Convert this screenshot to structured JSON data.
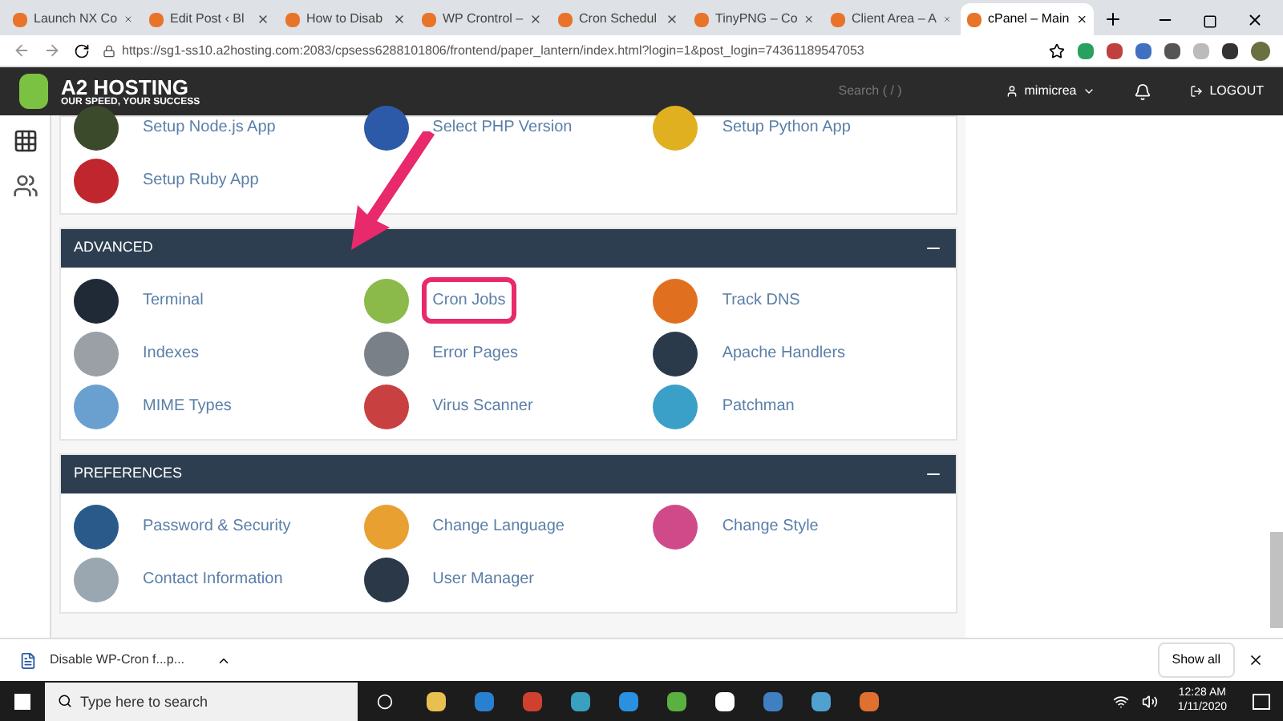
{
  "tabs": [
    {
      "label": "Launch NX Co",
      "selected": false
    },
    {
      "label": "Edit Post ‹ Bl",
      "selected": false
    },
    {
      "label": "How to Disab",
      "selected": false
    },
    {
      "label": "WP Crontrol –",
      "selected": false
    },
    {
      "label": "Cron Schedul",
      "selected": false
    },
    {
      "label": "TinyPNG – Co",
      "selected": false
    },
    {
      "label": "Client Area – A",
      "selected": false
    },
    {
      "label": "cPanel – Main",
      "selected": true
    }
  ],
  "address_bar": {
    "url": "https://sg1-ss10.a2hosting.com:2083/cpsess6288101806/frontend/paper_lantern/index.html?login=1&post_login=74361189547053"
  },
  "header": {
    "logo_title": "A2 HOSTING",
    "logo_tagline": "OUR SPEED, YOUR SUCCESS",
    "search": {
      "placeholder": "Search ( / )"
    },
    "user": "mimicrea",
    "logout": "LOGOUT"
  },
  "sections": [
    {
      "items": [
        {
          "label": "Setup Node.js App",
          "highlighted": false
        },
        {
          "label": "Select PHP Version",
          "highlighted": false
        },
        {
          "label": "Setup Python App",
          "highlighted": false
        },
        {
          "label": "Setup Ruby App",
          "highlighted": false
        }
      ]
    },
    {
      "title": "ADVANCED",
      "items": [
        {
          "label": "Terminal",
          "highlighted": false
        },
        {
          "label": "Cron Jobs",
          "highlighted": true
        },
        {
          "label": "Track DNS",
          "highlighted": false
        },
        {
          "label": "Indexes",
          "highlighted": false
        },
        {
          "label": "Error Pages",
          "highlighted": false
        },
        {
          "label": "Apache Handlers",
          "highlighted": false
        },
        {
          "label": "MIME Types",
          "highlighted": false
        },
        {
          "label": "Virus Scanner",
          "highlighted": false
        },
        {
          "label": "Patchman",
          "highlighted": false
        }
      ]
    },
    {
      "title": "PREFERENCES",
      "items": [
        {
          "label": "Password & Security",
          "highlighted": false
        },
        {
          "label": "Change Language",
          "highlighted": false
        },
        {
          "label": "Change Style",
          "highlighted": false
        },
        {
          "label": "Contact Information",
          "highlighted": false
        },
        {
          "label": "User Manager",
          "highlighted": false
        }
      ]
    }
  ],
  "download_bar": {
    "file": "Disable WP-Cron f...p...",
    "show_all": "Show all"
  },
  "taskbar": {
    "search": {
      "placeholder": "Type here to search"
    },
    "time": "12:28 AM",
    "date": "1/11/2020"
  }
}
